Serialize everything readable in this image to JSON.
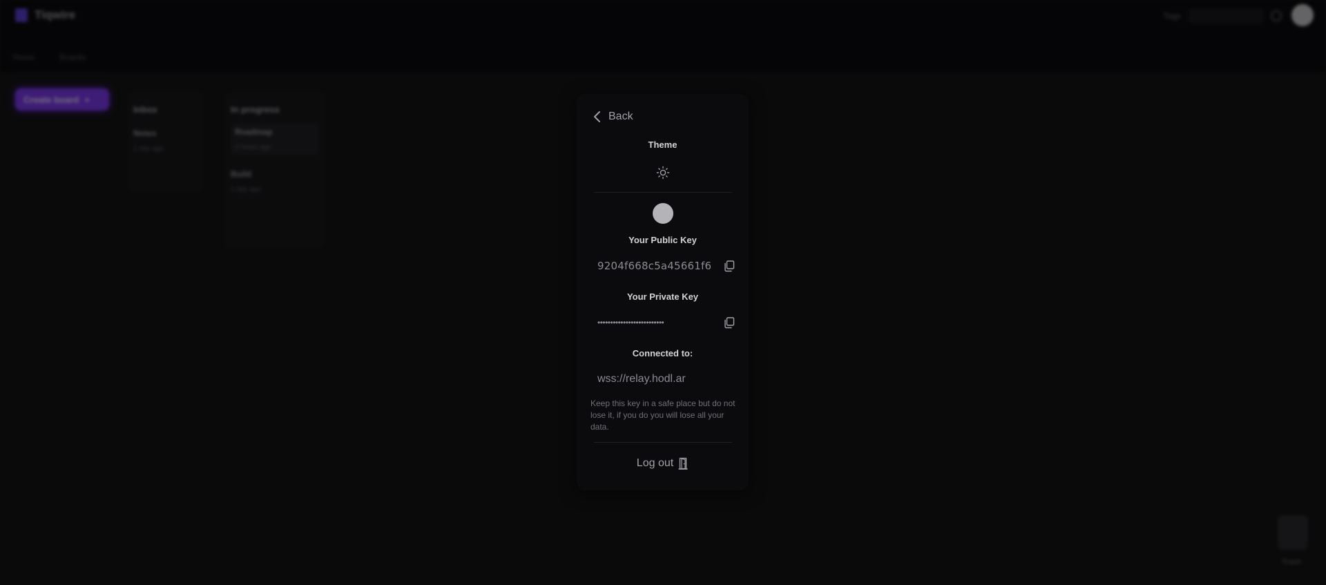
{
  "app": {
    "brand": "Tiqwire",
    "search_hint": "Tags",
    "breadcrumbs": [
      "Home",
      "Boards"
    ],
    "create_button": "Create board",
    "columns": [
      {
        "title": "Inbox",
        "items": [
          {
            "title": "Notes",
            "meta": "1 day ago"
          }
        ]
      },
      {
        "title": "In progress",
        "cards": [
          {
            "title": "Roadmap",
            "meta": "2 hours ago"
          }
        ],
        "items": [
          {
            "title": "Build",
            "meta": "1 day ago"
          }
        ]
      }
    ],
    "trash_label": "Trash"
  },
  "modal": {
    "back_label": "Back",
    "theme_title": "Theme",
    "theme_icon": "sun-icon",
    "public_key_title": "Your Public Key",
    "public_key": "9204f668c5a45661f6",
    "private_key_title": "Your Private Key",
    "private_key_masked": "••••••••••••••••••••••••••",
    "connected_title": "Connected to:",
    "relay_url": "wss://relay.hodl.ar",
    "note": "Keep this key in a safe place but do not lose it, if you do you will lose all your data.",
    "logout_label": "Log out",
    "logout_icon": "door-icon"
  },
  "colors": {
    "accent": "#7c3aed",
    "modal_bg": "#0b0b0d",
    "page_bg": "#141415"
  }
}
